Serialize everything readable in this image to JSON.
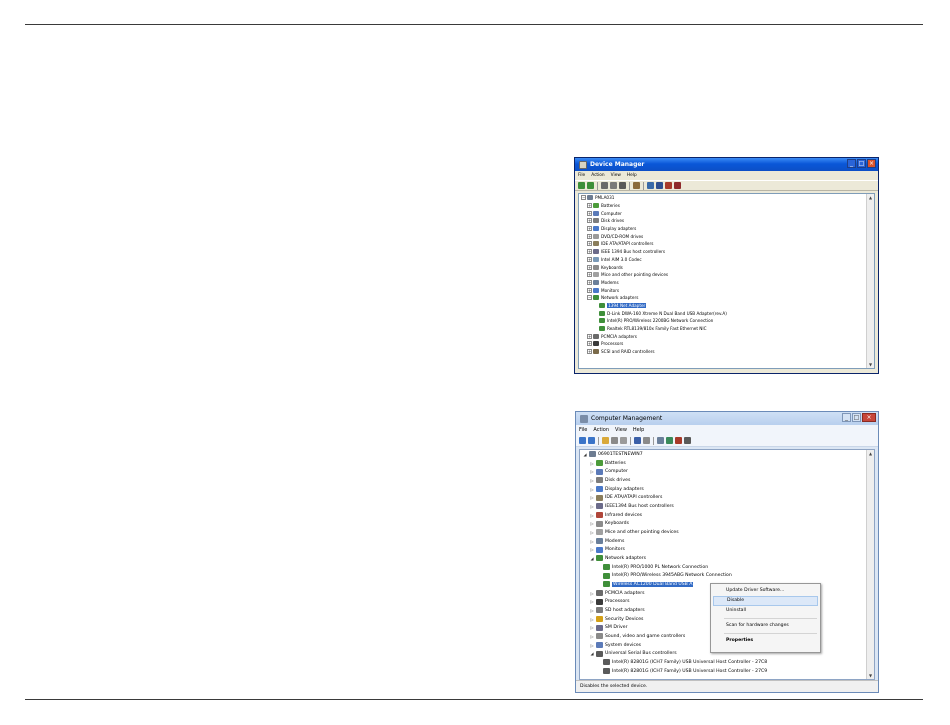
{
  "device_manager": {
    "title": "Device Manager",
    "menu": [
      "File",
      "Action",
      "View",
      "Help"
    ],
    "tree": [
      {
        "label": "PMLA031",
        "level": 0,
        "expander": "minus",
        "icon": "computer-icon",
        "color": "#6d7c91"
      },
      {
        "label": "Batteries",
        "level": 1,
        "expander": "plus",
        "icon": "battery-icon",
        "color": "#4c9b3a"
      },
      {
        "label": "Computer",
        "level": 1,
        "expander": "plus",
        "icon": "computer-icon",
        "color": "#5b7ab8"
      },
      {
        "label": "Disk drives",
        "level": 1,
        "expander": "plus",
        "icon": "disk-drive-icon",
        "color": "#7d7d7d"
      },
      {
        "label": "Display adapters",
        "level": 1,
        "expander": "plus",
        "icon": "display-adapter-icon",
        "color": "#4a79c9"
      },
      {
        "label": "DVD/CD-ROM drives",
        "level": 1,
        "expander": "plus",
        "icon": "dvd-drive-icon",
        "color": "#9a9a9a"
      },
      {
        "label": "IDE ATA/ATAPI controllers",
        "level": 1,
        "expander": "plus",
        "icon": "ide-controller-icon",
        "color": "#8a7d5b"
      },
      {
        "label": "IEEE 1394 Bus host controllers",
        "level": 1,
        "expander": "plus",
        "icon": "ieee1394-icon",
        "color": "#6b6b8a"
      },
      {
        "label": "Intel AIM 3.0 Codec",
        "level": 1,
        "expander": "plus",
        "icon": "codec-icon",
        "color": "#7a9ab8"
      },
      {
        "label": "Keyboards",
        "level": 1,
        "expander": "plus",
        "icon": "keyboard-icon",
        "color": "#8b8b8b"
      },
      {
        "label": "Mice and other pointing devices",
        "level": 1,
        "expander": "plus",
        "icon": "mouse-icon",
        "color": "#a0a0a0"
      },
      {
        "label": "Modems",
        "level": 1,
        "expander": "plus",
        "icon": "modem-icon",
        "color": "#6a7f9a"
      },
      {
        "label": "Monitors",
        "level": 1,
        "expander": "plus",
        "icon": "monitor-icon",
        "color": "#4a79c9"
      },
      {
        "label": "Network adapters",
        "level": 1,
        "expander": "minus",
        "icon": "network-adapter-icon",
        "color": "#3f8f3a"
      },
      {
        "label": "1394 Net Adapter",
        "level": 2,
        "expander": "none",
        "icon": "network-card-icon",
        "color": "#3f8f3a",
        "selected": true
      },
      {
        "label": "D-Link DWA-160 Xtreme N Dual Band USB Adapter(rev.A)",
        "level": 2,
        "expander": "none",
        "icon": "network-card-icon",
        "color": "#3f8f3a"
      },
      {
        "label": "Intel(R) PRO/Wireless 2200BG Network Connection",
        "level": 2,
        "expander": "none",
        "icon": "network-card-icon",
        "color": "#3f8f3a"
      },
      {
        "label": "Realtek RTL8139/810x Family Fast Ethernet NIC",
        "level": 2,
        "expander": "none",
        "icon": "network-card-icon",
        "color": "#3f8f3a"
      },
      {
        "label": "PCMCIA adapters",
        "level": 1,
        "expander": "plus",
        "icon": "pcmcia-icon",
        "color": "#6a6a6a"
      },
      {
        "label": "Processors",
        "level": 1,
        "expander": "plus",
        "icon": "processor-icon",
        "color": "#3a3a3a"
      },
      {
        "label": "SCSI and RAID controllers",
        "level": 1,
        "expander": "plus",
        "icon": "scsi-icon",
        "color": "#7a6a4a"
      }
    ]
  },
  "computer_management": {
    "title": "Computer Management",
    "menu": [
      "File",
      "Action",
      "View",
      "Help"
    ],
    "tree": [
      {
        "label": "06901TESTNEWIN7",
        "level": 0,
        "expander": "open",
        "icon": "computer-icon",
        "color": "#6d7c91"
      },
      {
        "label": "Batteries",
        "level": 1,
        "expander": "closed",
        "icon": "battery-icon",
        "color": "#4c9b3a"
      },
      {
        "label": "Computer",
        "level": 1,
        "expander": "closed",
        "icon": "computer-icon",
        "color": "#5b7ab8"
      },
      {
        "label": "Disk drives",
        "level": 1,
        "expander": "closed",
        "icon": "disk-drive-icon",
        "color": "#7d7d7d"
      },
      {
        "label": "Display adapters",
        "level": 1,
        "expander": "closed",
        "icon": "display-adapter-icon",
        "color": "#4a79c9"
      },
      {
        "label": "IDE ATA/ATAPI controllers",
        "level": 1,
        "expander": "closed",
        "icon": "ide-controller-icon",
        "color": "#8a7d5b"
      },
      {
        "label": "IEEE1394 Bus host controllers",
        "level": 1,
        "expander": "closed",
        "icon": "ieee1394-icon",
        "color": "#6b6b8a"
      },
      {
        "label": "Infrared devices",
        "level": 1,
        "expander": "closed",
        "icon": "infrared-icon",
        "color": "#b0463a"
      },
      {
        "label": "Keyboards",
        "level": 1,
        "expander": "closed",
        "icon": "keyboard-icon",
        "color": "#8b8b8b"
      },
      {
        "label": "Mice and other pointing devices",
        "level": 1,
        "expander": "closed",
        "icon": "mouse-icon",
        "color": "#a0a0a0"
      },
      {
        "label": "Modems",
        "level": 1,
        "expander": "closed",
        "icon": "modem-icon",
        "color": "#6a7f9a"
      },
      {
        "label": "Monitors",
        "level": 1,
        "expander": "closed",
        "icon": "monitor-icon",
        "color": "#4a79c9"
      },
      {
        "label": "Network adapters",
        "level": 1,
        "expander": "open",
        "icon": "network-adapter-icon",
        "color": "#3f8f3a"
      },
      {
        "label": "Intel(R) PRO/1000 PL Network Connection",
        "level": 2,
        "expander": "none",
        "icon": "network-card-icon",
        "color": "#3f8f3a"
      },
      {
        "label": "Intel(R) PRO/Wireless 3945ABG Network Connection",
        "level": 2,
        "expander": "none",
        "icon": "network-card-icon",
        "color": "#3f8f3a"
      },
      {
        "label": "Wireless AC1200 Dual Band USB A",
        "level": 2,
        "expander": "none",
        "icon": "network-card-icon",
        "color": "#3f8f3a",
        "selected": true
      },
      {
        "label": "PCMCIA adapters",
        "level": 1,
        "expander": "closed",
        "icon": "pcmcia-icon",
        "color": "#6a6a6a"
      },
      {
        "label": "Processors",
        "level": 1,
        "expander": "closed",
        "icon": "processor-icon",
        "color": "#3a3a3a"
      },
      {
        "label": "SD host adapters",
        "level": 1,
        "expander": "closed",
        "icon": "sd-adapter-icon",
        "color": "#7a7a7a"
      },
      {
        "label": "Security Devices",
        "level": 1,
        "expander": "closed",
        "icon": "security-device-icon",
        "color": "#d4a017"
      },
      {
        "label": "SM Driver",
        "level": 1,
        "expander": "closed",
        "icon": "driver-icon",
        "color": "#6a6a8a"
      },
      {
        "label": "Sound, video and game controllers",
        "level": 1,
        "expander": "closed",
        "icon": "sound-icon",
        "color": "#8a8a8a"
      },
      {
        "label": "System devices",
        "level": 1,
        "expander": "closed",
        "icon": "system-device-icon",
        "color": "#5b7ab8"
      },
      {
        "label": "Universal Serial Bus controllers",
        "level": 1,
        "expander": "open",
        "icon": "usb-icon",
        "color": "#5a5a5a"
      },
      {
        "label": "Intel(R) 82801G (ICH7 Family) USB Universal Host Controller - 27C8",
        "level": 2,
        "expander": "none",
        "icon": "usb-device-icon",
        "color": "#5a5a5a"
      },
      {
        "label": "Intel(R) 82801G (ICH7 Family) USB Universal Host Controller - 27C9",
        "level": 2,
        "expander": "none",
        "icon": "usb-device-icon",
        "color": "#5a5a5a"
      }
    ],
    "context_menu": {
      "update_driver": "Update Driver Software...",
      "disable": "Disable",
      "uninstall": "Uninstall",
      "scan": "Scan for hardware changes",
      "properties": "Properties"
    },
    "status_text": "Disables the selected device."
  }
}
